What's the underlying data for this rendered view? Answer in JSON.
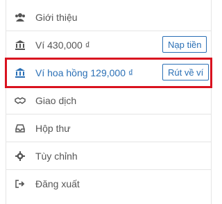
{
  "menu": {
    "about": {
      "label": "Giới thiệu",
      "icon": "users-icon"
    },
    "wallet": {
      "label": "Ví 430,000 ₫",
      "icon": "bank-icon",
      "action": "Nạp tiền"
    },
    "commission_wallet": {
      "label": "Ví hoa hồng 129,000 ₫",
      "icon": "bank-icon",
      "action": "Rút về ví"
    },
    "transactions": {
      "label": "Giao dịch",
      "icon": "handshake-icon"
    },
    "inbox": {
      "label": "Hộp thư",
      "icon": "inbox-icon"
    },
    "settings": {
      "label": "Tùy chỉnh",
      "icon": "gear-icon"
    },
    "logout": {
      "label": "Đăng xuất",
      "icon": "sign-out-icon"
    }
  },
  "colors": {
    "accent": "#2a6fb5",
    "highlight_border": "#d9121f",
    "text": "#555555"
  }
}
